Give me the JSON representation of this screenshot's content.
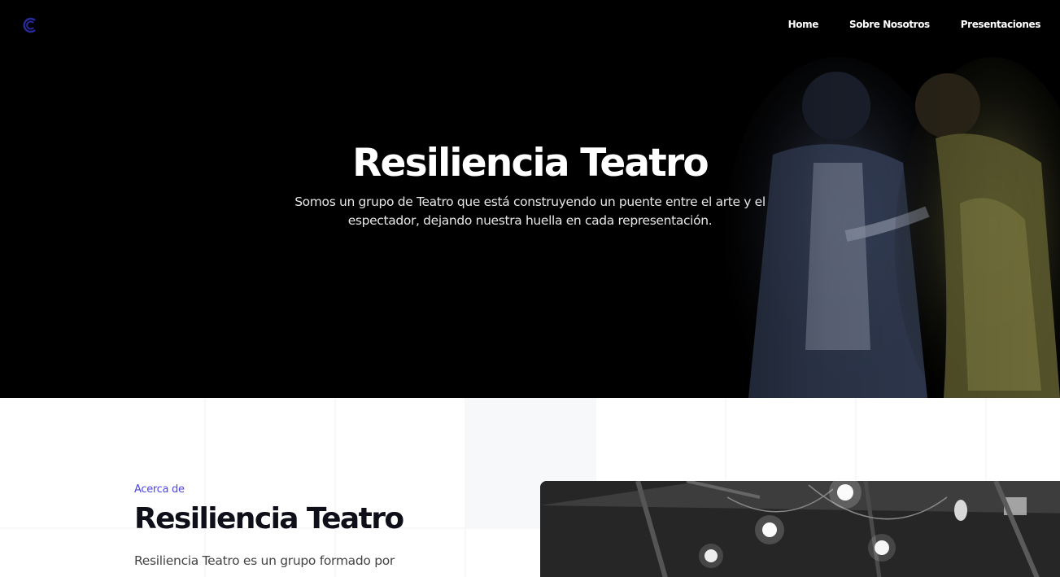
{
  "header": {
    "logo_icon": "c-logo-icon",
    "nav": [
      {
        "label": "Home"
      },
      {
        "label": "Sobre Nosotros"
      },
      {
        "label": "Presentaciones"
      }
    ]
  },
  "hero": {
    "title": "Resiliencia Teatro",
    "subtitle": "Somos un grupo de Teatro que está construyendo un puente entre el arte y el espectador, dejando nuestra huella en cada representación."
  },
  "about": {
    "eyebrow": "Acerca de",
    "title": "Resiliencia Teatro",
    "text": "Resiliencia Teatro es un grupo formado por"
  },
  "colors": {
    "accent": "#4f46e5",
    "hero_bg": "#000000",
    "title_dark": "#0f0f1a"
  }
}
